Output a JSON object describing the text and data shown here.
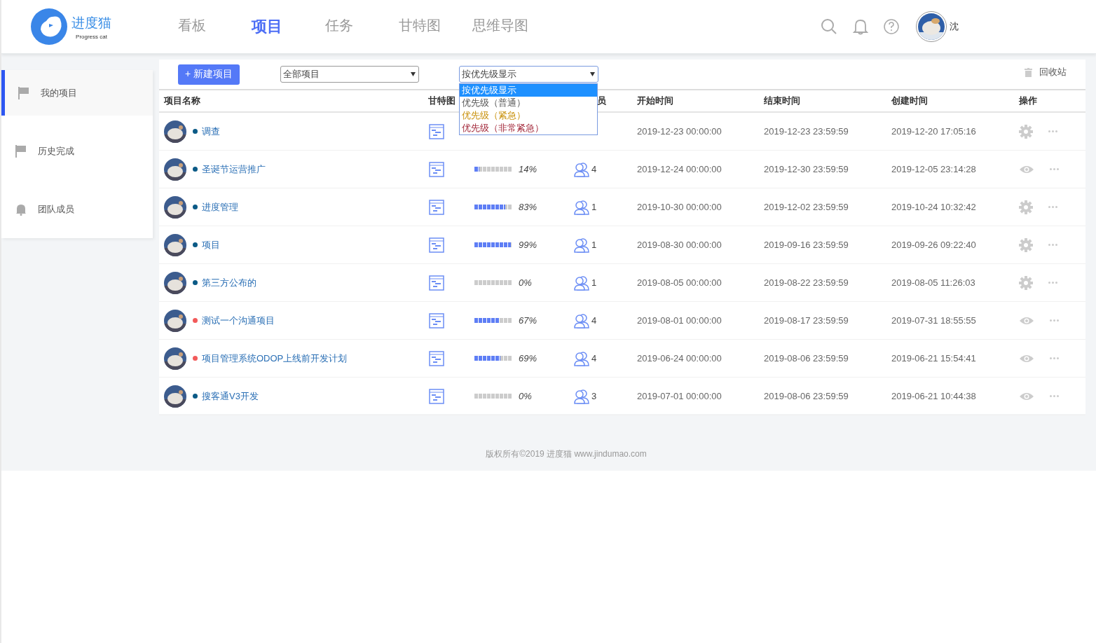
{
  "logo": {
    "name": "进度猫",
    "tagline": "Progress cat"
  },
  "nav": [
    {
      "label": "看板",
      "selected": false
    },
    {
      "label": "项目",
      "selected": true
    },
    {
      "label": "任务",
      "selected": false
    },
    {
      "label": "甘特图",
      "selected": false
    },
    {
      "label": "思维导图",
      "selected": false
    }
  ],
  "user": {
    "name": "沈"
  },
  "sidebar": {
    "items": [
      {
        "label": "我的项目",
        "selected": true
      },
      {
        "label": "历史完成",
        "selected": false
      },
      {
        "label": "团队成员",
        "selected": false
      }
    ]
  },
  "toolbar": {
    "new_button": "+ 新建项目",
    "filter": {
      "value": "全部项目"
    },
    "sort": {
      "value": "按优先级显示",
      "expanded": true,
      "options": [
        {
          "label": "按优先级显示",
          "selected": true
        },
        {
          "label": "优先级（普通）",
          "selected": false,
          "color": "#555555"
        },
        {
          "label": "优先级（紧急）",
          "selected": false,
          "color": "#c8900a"
        },
        {
          "label": "优先级（非常紧急）",
          "selected": false,
          "color": "#a3283a"
        }
      ]
    },
    "recycle": "回收站"
  },
  "table": {
    "columns": [
      "项目名称",
      "甘特图",
      "",
      "员",
      "开始时间",
      "结束时间",
      "创建时间",
      "操作"
    ],
    "rows": [
      {
        "name": "调查",
        "color": "#0b5a86",
        "start": "2019-12-23 00:00:00",
        "end": "2019-12-23 23:59:59",
        "created": "2019-12-20 17:05:16",
        "kind": "settings"
      },
      {
        "name": "圣诞节运营推广",
        "color": "#0b5a86",
        "level": 0.14,
        "progress": "14%",
        "members": "4",
        "start": "2019-12-24 00:00:00",
        "end": "2019-12-30 23:59:59",
        "created": "2019-12-05 23:14:28",
        "kind": "view"
      },
      {
        "name": "进度管理",
        "color": "#0b5a86",
        "level": 0.83,
        "progress": "83%",
        "members": "1",
        "start": "2019-10-30 00:00:00",
        "end": "2019-12-02 23:59:59",
        "created": "2019-10-24 10:32:42",
        "kind": "settings"
      },
      {
        "name": "项目",
        "color": "#0b5a86",
        "level": 0.99,
        "progress": "99%",
        "members": "1",
        "start": "2019-08-30 00:00:00",
        "end": "2019-09-16 23:59:59",
        "created": "2019-09-26 09:22:40",
        "kind": "settings"
      },
      {
        "name": "第三方公布的",
        "color": "#0b5a86",
        "level": 0,
        "progress": "0%",
        "members": "1",
        "start": "2019-08-05 00:00:00",
        "end": "2019-08-22 23:59:59",
        "created": "2019-08-05 11:26:03",
        "kind": "settings"
      },
      {
        "name": "测试一个沟通项目",
        "color": "#f25a5a",
        "level": 0.67,
        "progress": "67%",
        "members": "4",
        "start": "2019-08-01 00:00:00",
        "end": "2019-08-17 23:59:59",
        "created": "2019-07-31 18:55:55",
        "kind": "view"
      },
      {
        "name": "项目管理系统ODOP上线前开发计划",
        "color": "#f25a5a",
        "level": 0.69,
        "progress": "69%",
        "members": "4",
        "start": "2019-06-24 00:00:00",
        "end": "2019-08-06 23:59:59",
        "created": "2019-06-21 15:54:41",
        "kind": "view"
      },
      {
        "name": "搜客通V3开发",
        "color": "#0b5a86",
        "level": 0,
        "progress": "0%",
        "members": "3",
        "start": "2019-07-01 00:00:00",
        "end": "2019-08-06 23:59:59",
        "created": "2019-06-21 10:44:38",
        "kind": "view"
      }
    ]
  },
  "footer": "版权所有©2019 进度猫 www.jindumao.com"
}
